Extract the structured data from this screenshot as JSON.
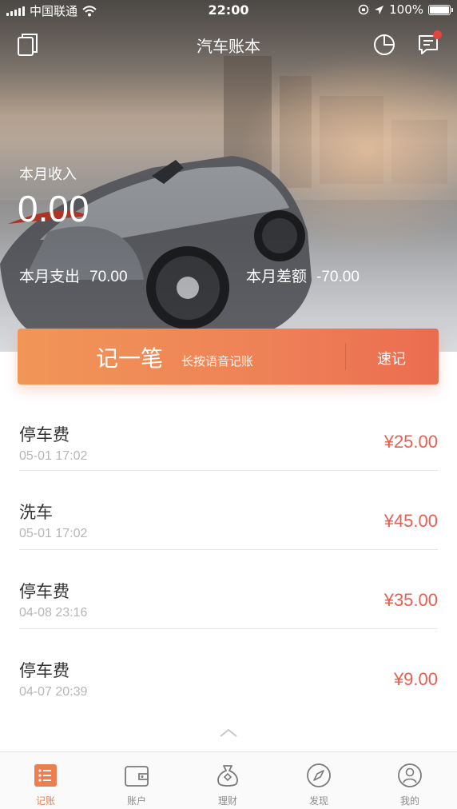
{
  "status_bar": {
    "carrier": "中国联通",
    "time": "22:00",
    "battery": "100%",
    "icons": [
      "signal-icon",
      "wifi-icon",
      "rotation-lock-icon",
      "location-arrow-icon",
      "battery-icon"
    ]
  },
  "header": {
    "title": "汽车账本",
    "left_icon": "books-icon",
    "right_icons": [
      "pie-chart-icon",
      "message-icon"
    ],
    "message_badge": true
  },
  "summary": {
    "income_label": "本月收入",
    "income_value": "0.00",
    "expense_label": "本月支出",
    "expense_value": "70.00",
    "balance_label": "本月差额",
    "balance_value": "-70.00"
  },
  "record_bar": {
    "main_label": "记一笔",
    "sub_label": "长按语音记账",
    "quick_label": "速记"
  },
  "transactions": [
    {
      "name": "停车费",
      "time": "05-01 17:02",
      "amount": "¥25.00"
    },
    {
      "name": "洗车",
      "time": "05-01 17:02",
      "amount": "¥45.00"
    },
    {
      "name": "停车费",
      "time": "04-08 23:16",
      "amount": "¥35.00"
    },
    {
      "name": "停车费",
      "time": "04-07 20:39",
      "amount": "¥9.00"
    }
  ],
  "tabs": [
    {
      "label": "记账",
      "icon": "list-icon",
      "active": true
    },
    {
      "label": "账户",
      "icon": "wallet-icon",
      "active": false
    },
    {
      "label": "理财",
      "icon": "money-bag-icon",
      "active": false
    },
    {
      "label": "发现",
      "icon": "compass-icon",
      "active": false
    },
    {
      "label": "我的",
      "icon": "user-icon",
      "active": false
    }
  ],
  "colors": {
    "accent": "#ee7d50",
    "amount": "#ea5d50",
    "record_bar_start": "#f19657",
    "record_bar_end": "#eb6c50"
  }
}
